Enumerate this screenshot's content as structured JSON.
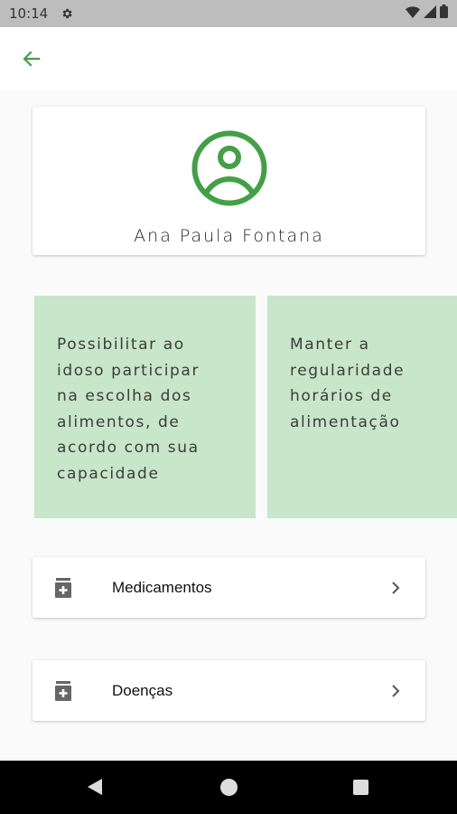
{
  "status_bar": {
    "time": "10:14"
  },
  "profile": {
    "name": "Ana Paula Fontana"
  },
  "tips": [
    {
      "text": "Possibilitar ao\nidoso participar\nna escolha dos\nalimentos, de\nacordo com sua\ncapacidade"
    },
    {
      "text": "Manter a\nregularidade\nhorários de\nalimentação"
    }
  ],
  "menu": {
    "items": [
      {
        "label": "Medicamentos"
      },
      {
        "label": "Doenças"
      }
    ]
  },
  "colors": {
    "accent": "#43a047",
    "tip_background": "#c8e6c9"
  }
}
